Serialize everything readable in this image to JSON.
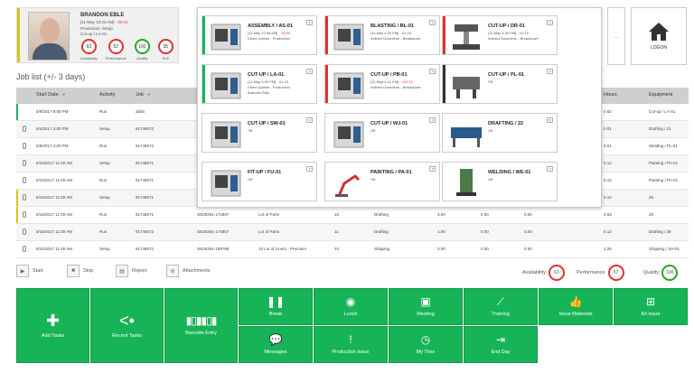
{
  "operator": {
    "name": "BRANDON EBLE",
    "line1_prefix": "[11-May 10:23 AM] -",
    "line1_red": "00:41",
    "line2": "Production: Setup",
    "line3": "Cut-up / LA-01",
    "gauges": [
      {
        "label": "Availability",
        "value": "63",
        "color": "red"
      },
      {
        "label": "Performance",
        "value": "52",
        "color": "red"
      },
      {
        "label": "Quality",
        "value": "100",
        "color": "green"
      },
      {
        "label": "OLE",
        "value": "35",
        "color": "red"
      }
    ]
  },
  "more_label": "...",
  "logon_label": "LOGON",
  "joblist_title": "Job list (+/- 3 days)",
  "table": {
    "headers": {
      "start_date": "Start Date",
      "activity": "Activity",
      "job": "Job",
      "hours": "Hours",
      "equipment": "Equipment"
    },
    "rows": [
      {
        "date": "5/9/2017 9:00 PM",
        "activity": "Run",
        "job": "abbit",
        "order": "",
        "part": "",
        "qty": "",
        "op": "",
        "c1": "",
        "c2": "",
        "c3": "",
        "hours": "0.62",
        "equipment": "Cut-up / LA-01",
        "bar": "#17b457",
        "clip": false
      },
      {
        "date": "5/4/2017 4:00 PM",
        "activity": "Setup",
        "job": "91746572",
        "order": "",
        "part": "",
        "qty": "",
        "op": "",
        "c1": "",
        "c2": "",
        "c3": "",
        "hours": "0.01",
        "equipment": "Drafting / 21",
        "bar": "",
        "clip": true
      },
      {
        "date": "5/9/2017 2:00 PM",
        "activity": "Run",
        "job": "91746572",
        "order": "",
        "part": "",
        "qty": "",
        "op": "",
        "c1": "",
        "c2": "",
        "c3": "",
        "hours": "0.01",
        "equipment": "Welding / PL-01",
        "bar": "",
        "clip": true
      },
      {
        "date": "5/10/2017 11:00 AM",
        "activity": "Setup",
        "job": "91746571",
        "order": "",
        "part": "",
        "qty": "",
        "op": "",
        "c1": "",
        "c2": "",
        "c3": "",
        "hours": "0.12",
        "equipment": "Painting / PA-01",
        "bar": "",
        "clip": true
      },
      {
        "date": "5/10/2017 11:00 AM",
        "activity": "Run",
        "job": "91746571",
        "order": "",
        "part": "",
        "qty": "",
        "op": "",
        "c1": "",
        "c2": "",
        "c3": "",
        "hours": "0.12",
        "equipment": "Painting / PA-01",
        "bar": "",
        "clip": true
      },
      {
        "date": "5/16/2017 11:00 AM",
        "activity": "Setup",
        "job": "91746571",
        "order": "",
        "part": "",
        "qty": "",
        "op": "",
        "c1": "",
        "c2": "",
        "c3": "",
        "hours": "0.12",
        "equipment": "26",
        "bar": "#d6c61a",
        "clip": true
      },
      {
        "date": "5/16/2017 11:00 AM",
        "activity": "Run",
        "job": "91746571",
        "order": "SN20281-174857",
        "part": "Lot of Parts",
        "qty": "10",
        "op": "Drafting",
        "c1": "3.00",
        "c2": "0.00",
        "c3": "0.00",
        "hours": "0.63",
        "equipment": "26",
        "bar": "#d6c61a",
        "clip": true
      },
      {
        "date": "5/16/2017 11:00 AM",
        "activity": "Run",
        "job": "91746572",
        "order": "SN20281-174857",
        "part": "Lot of Parts",
        "qty": "11",
        "op": "Drafting",
        "c1": "1.00",
        "c2": "0.00",
        "c3": "0.00",
        "hours": "0.12",
        "equipment": "Drafting / 39",
        "bar": "",
        "clip": true
      },
      {
        "date": "5/22/2017 11:00 AM",
        "activity": "Setup",
        "job": "91746572",
        "order": "SN20281-159788",
        "part": "10 Lot of Liners - Premium",
        "qty": "34",
        "op": "Shipping",
        "c1": "3.00",
        "c2": "0.00",
        "c3": "0.00",
        "hours": "1.25",
        "equipment": "Shipping / SH-01",
        "bar": "",
        "clip": true
      }
    ]
  },
  "machines": [
    {
      "title": "ASSEMBLY / AS-01",
      "sub1": "[11-May 10:06 AM] -",
      "sub1_red": "10:00",
      "sub2": "Direct Uptime - Production",
      "bar": "#17b457",
      "icon": "cnc-machine-icon"
    },
    {
      "title": "BLASTING / BL-01",
      "sub1": "[11-May 4:33 PM] - 01:16",
      "sub1_red": "",
      "sub2": "Indirect Downtime - Breakdown",
      "bar": "#d33",
      "icon": "cnc-machine-icon"
    },
    {
      "title": "CUT-UP / DR-01",
      "sub1": "[11-May 4:30 PM] - 01:19",
      "sub1_red": "",
      "sub2": "Indirect Downtime - Breakdown",
      "bar": "#d33",
      "icon": "drill-press-icon"
    },
    {
      "title": "CUT-UP / LA-01",
      "sub1": "[11-May 9:00 PM] - 01:15",
      "sub1_red": "",
      "sub2": "Direct Uptime - Production",
      "sub3": "Brandon Eble",
      "bar": "#17b457",
      "icon": "cnc-machine-icon"
    },
    {
      "title": "CUT-UP / PB-01",
      "sub1": "[11-May 4:41 PM] -",
      "sub1_red": "102:11",
      "sub2": "Indirect Downtime - Breakdown",
      "bar": "#d33",
      "icon": "cnc-machine-icon"
    },
    {
      "title": "CUT-UP / PL-01",
      "sub1": "Off",
      "sub1_red": "",
      "sub2": "",
      "bar": "#333",
      "icon": "lathe-icon"
    },
    {
      "title": "CUT-UP / SW-01",
      "sub1": "Off",
      "sub1_red": "",
      "sub2": "",
      "bar": "",
      "icon": "cnc-machine-icon"
    },
    {
      "title": "CUT-UP / WJ-01",
      "sub1": "Off",
      "sub1_red": "",
      "sub2": "",
      "bar": "",
      "icon": "cnc-machine-icon"
    },
    {
      "title": "DRAFTING / 22",
      "sub1": "Off",
      "sub1_red": "",
      "sub2": "",
      "bar": "",
      "icon": "drafting-table-icon"
    },
    {
      "title": "FIT-UP / FU-01",
      "sub1": "Off",
      "sub1_red": "",
      "sub2": "",
      "bar": "",
      "icon": "cnc-machine-icon"
    },
    {
      "title": "PAINTING / PA-01",
      "sub1": "Off",
      "sub1_red": "",
      "sub2": "",
      "bar": "",
      "icon": "painting-arm-icon"
    },
    {
      "title": "WELDING / WE-01",
      "sub1": "Off",
      "sub1_red": "",
      "sub2": "",
      "bar": "",
      "icon": "welder-icon"
    }
  ],
  "actions": [
    {
      "label": "Start",
      "icon": "play-icon"
    },
    {
      "label": "Stop",
      "icon": "stop-icon"
    },
    {
      "label": "Report",
      "icon": "report-icon"
    },
    {
      "label": "Attachments",
      "icon": "attachment-icon"
    }
  ],
  "kpis": [
    {
      "label": "Availability",
      "value": "63",
      "color": "red"
    },
    {
      "label": "Performance",
      "value": "57",
      "color": "red"
    },
    {
      "label": "Quality",
      "value": "100",
      "color": "green"
    }
  ],
  "tiles": {
    "add_tasks": "Add Tasks",
    "recent_tasks": "Recent Tasks",
    "barcode_entry": "Barcode Entry",
    "break": "Break",
    "lunch": "Lunch",
    "meeting": "Meeting",
    "training": "Training",
    "issue_materials": "Issue Materials",
    "kit_issue": "Kit Issue",
    "messages": "Messages",
    "production_issue": "Production Issue",
    "my_time": "My Time",
    "end_day": "End Day"
  },
  "colors": {
    "accent": "#17b457",
    "alert": "#dd3333",
    "warning": "#d6c61a"
  }
}
